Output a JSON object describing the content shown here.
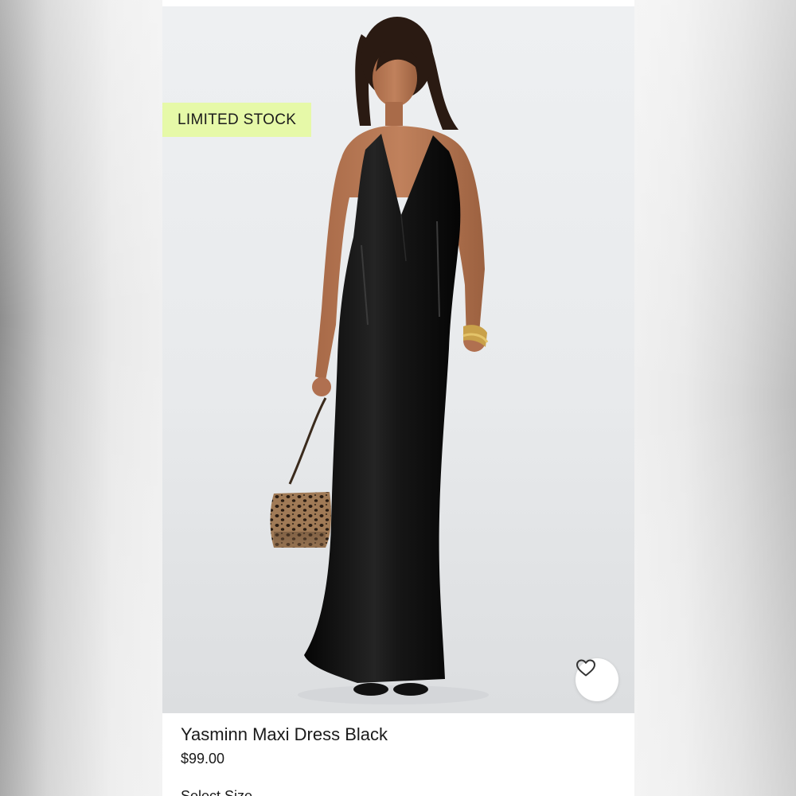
{
  "product": {
    "badge": "LIMITED STOCK",
    "title": "Yasminn Maxi Dress Black",
    "price": "$99.00",
    "size_label": "Select Size"
  },
  "icons": {
    "favorite": "heart-outline-icon"
  },
  "colors": {
    "badge_background": "#e6f9a8",
    "text": "#1a1a1a",
    "photo_background": "#eceeef",
    "dress": "#0e0e0e"
  }
}
